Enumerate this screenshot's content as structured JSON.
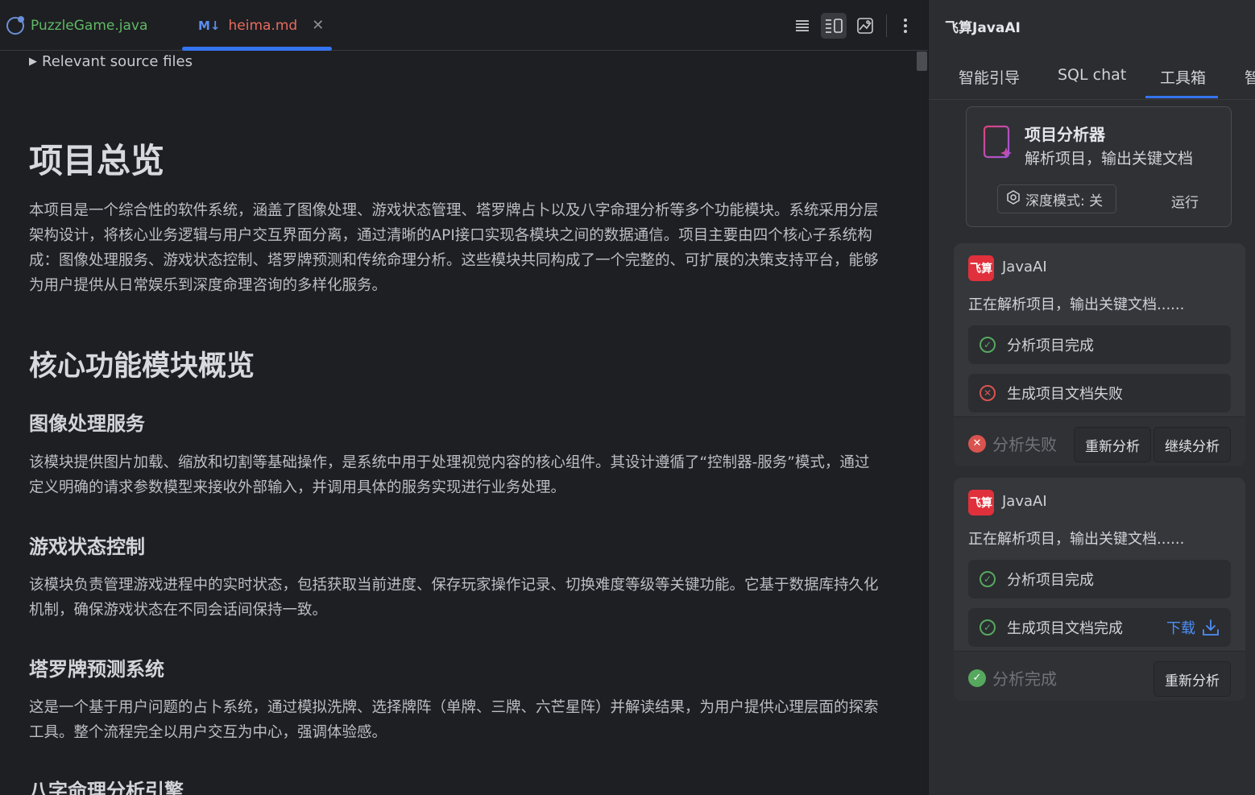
{
  "editor": {
    "tabs": [
      {
        "label": "PuzzleGame.java",
        "icon": "java-class-icon"
      },
      {
        "label": "heima.md",
        "badge": "M↓",
        "icon": "markdown-icon",
        "active": true
      }
    ],
    "summary": "Relevant source files",
    "h1": "项目总览",
    "intro": "本项目是一个综合性的软件系统，涵盖了图像处理、游戏状态管理、塔罗牌占卜以及八字命理分析等多个功能模块。系统采用分层架构设计，将核心业务逻辑与用户交互界面分离，通过清晰的API接口实现各模块之间的数据通信。项目主要由四个核心子系统构成：图像处理服务、游戏状态控制、塔罗牌预测和传统命理分析。这些模块共同构成了一个完整的、可扩展的决策支持平台，能够为用户提供从日常娱乐到深度命理咨询的多样化服务。",
    "h2": "核心功能模块概览",
    "sections": [
      {
        "title": "图像处理服务",
        "text": "该模块提供图片加载、缩放和切割等基础操作，是系统中用于处理视觉内容的核心组件。其设计遵循了“控制器-服务”模式，通过定义明确的请求参数模型来接收外部输入，并调用具体的服务实现进行业务处理。"
      },
      {
        "title": "游戏状态控制",
        "text": "该模块负责管理游戏进程中的实时状态，包括获取当前进度、保存玩家操作记录、切换难度等级等关键功能。它基于数据库持久化机制，确保游戏状态在不同会话间保持一致。"
      },
      {
        "title": "塔罗牌预测系统",
        "text": "这是一个基于用户问题的占卜系统，通过模拟洗牌、选择牌阵（单牌、三牌、六芒星阵）并解读结果，为用户提供心理层面的探索工具。整个流程完全以用户交互为中心，强调体验感。"
      },
      {
        "title": "八字命理分析引擎",
        "text": ""
      }
    ]
  },
  "panel": {
    "title": "飞算JavaAI",
    "tabs": [
      "智能引导",
      "SQL chat",
      "工具箱",
      "智"
    ],
    "active_tab": "工具箱",
    "tool": {
      "name": "项目分析器",
      "desc": "解析项目，输出关键文档",
      "deep_mode": "深度模式: 关",
      "run": "运行"
    },
    "messages": [
      {
        "logo": "飞算",
        "brand": "JavaAI",
        "text": "正在解析项目，输出关键文档......",
        "steps": [
          {
            "label": "分析项目完成",
            "state": "ok"
          },
          {
            "label": "生成项目文档失败",
            "state": "error"
          }
        ],
        "status": "分析失败",
        "status_state": "error",
        "buttons": [
          "重新分析",
          "继续分析"
        ]
      },
      {
        "logo": "飞算",
        "brand": "JavaAI",
        "text": "正在解析项目，输出关键文档......",
        "steps": [
          {
            "label": "分析项目完成",
            "state": "ok"
          },
          {
            "label": "生成项目文档完成",
            "state": "ok",
            "action": "下载"
          }
        ],
        "status": "分析完成",
        "status_state": "ok",
        "buttons": [
          "重新分析"
        ]
      }
    ]
  },
  "colors": {
    "accent": "#3574f0",
    "ok": "#56a85f",
    "error": "#d9534f",
    "brand": "#e0303b",
    "link": "#4e8ef7"
  }
}
